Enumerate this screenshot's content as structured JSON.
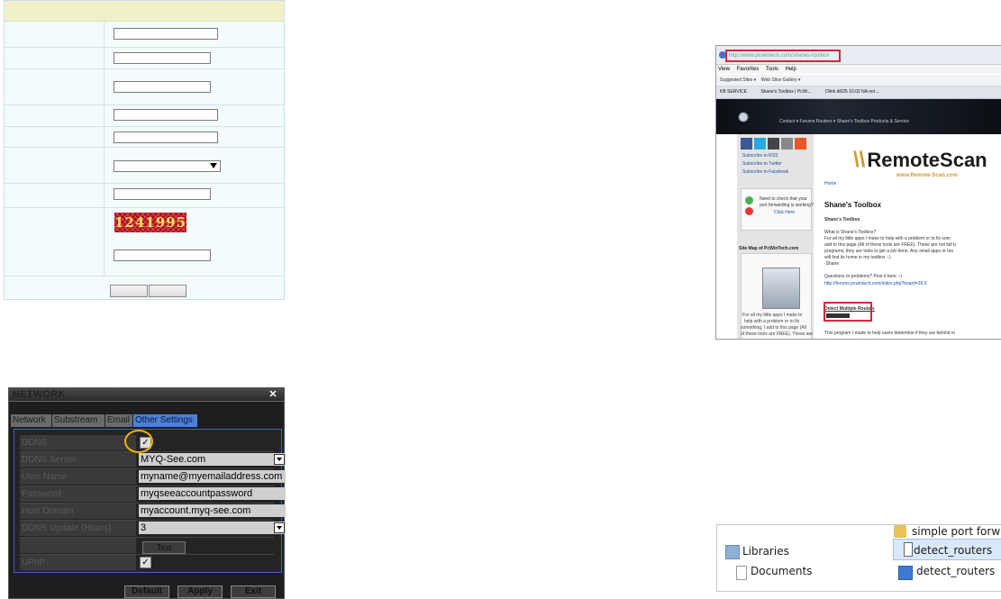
{
  "dvr": {
    "title": "NETWORK",
    "close_label": "✕",
    "tabs": [
      "Network",
      "Substream",
      "Email",
      "Other Settings"
    ],
    "rows": [
      {
        "label": "DDNS",
        "type": "checkbox",
        "checked": true
      },
      {
        "label": "DDNS Server",
        "type": "select",
        "value": "MYQ-See.com"
      },
      {
        "label": "User Name",
        "type": "text",
        "value": "myname@myemailaddress.com"
      },
      {
        "label": "Password",
        "type": "text",
        "value": "myqseeaccountpassword"
      },
      {
        "label": "Host Domain",
        "type": "text",
        "value": "myaccount.myq-see.com"
      },
      {
        "label": "DDNS Update (Hours)",
        "type": "select",
        "value": "3"
      },
      {
        "label": "",
        "type": "button",
        "value": "Test"
      },
      {
        "label": "UPnP",
        "type": "checkbox",
        "checked": true
      }
    ],
    "buttons": {
      "default": "Default",
      "apply": "Apply",
      "exit": "Exit"
    },
    "accent_color": "#4d7fd6",
    "highlight_color": "#f2b400"
  },
  "form": {
    "captcha_text": "1241995",
    "header_color": "#f1f1c9"
  },
  "browser": {
    "url": "http://www.pcwintech.com/shanes-toolbox",
    "menu": [
      "View",
      "Favorites",
      "Tools",
      "Help"
    ],
    "favorites": [
      "Suggested Sites ▾",
      "Web Slice Gallery ▾"
    ],
    "tabs": [
      "KB SERVICE",
      "Shane's Toolbox | PcWi...",
      "Dlink di625 10.02 NA not ..."
    ],
    "nav": "Contact ▾   Forums   Routers ▾   Shane's Toolbox   Products & Service",
    "subscribe": [
      "Subscribe to RSS",
      "Subscribe to Twitter",
      "Subscribe to Facebook"
    ],
    "port_check": [
      "Need to check that your",
      "port forwarding is working?",
      "Click Here"
    ],
    "site_map": "Site Map of PcWinTech.com",
    "side_text": [
      "For all my little apps I make to",
      "help with a problem or to fix",
      "something, I add to this page (All",
      "of these tools are FREE). These are"
    ],
    "brand": "RemoteScan",
    "brand_url": "www.Remote-Scan.com",
    "home": "Home",
    "page_title": "Shane's Toolbox",
    "section": "Shane's Toolbox",
    "body_lines": [
      "What is Shane's Toolbox?",
      "For all my little apps I make to help with a problem or to fix som",
      "add to this page (All of these tools are FREE). These are not full b",
      "programs, they are tools to get a job done. Any small apps or too",
      "will find its home in my toolbox :-)",
      "-Shane",
      "",
      "Questions or problems? Post it here :-)",
      "http://forums.pcwintech.com/index.php?board=35.0"
    ],
    "detect_title": "Detect Multiple Routers",
    "footer_line": "This program I made to help users determine if they are behind m",
    "highlight_color": "#d12a3a"
  },
  "explorer": {
    "items": [
      {
        "label": "simple port forward",
        "icon": "folder-icon"
      },
      {
        "label": "Libraries",
        "icon": "libraries-icon"
      },
      {
        "label": "detect_routers",
        "icon": "zip-icon"
      },
      {
        "label": "Documents",
        "icon": "documents-icon"
      },
      {
        "label": "detect_routers",
        "icon": "monitor-app-icon"
      }
    ]
  }
}
